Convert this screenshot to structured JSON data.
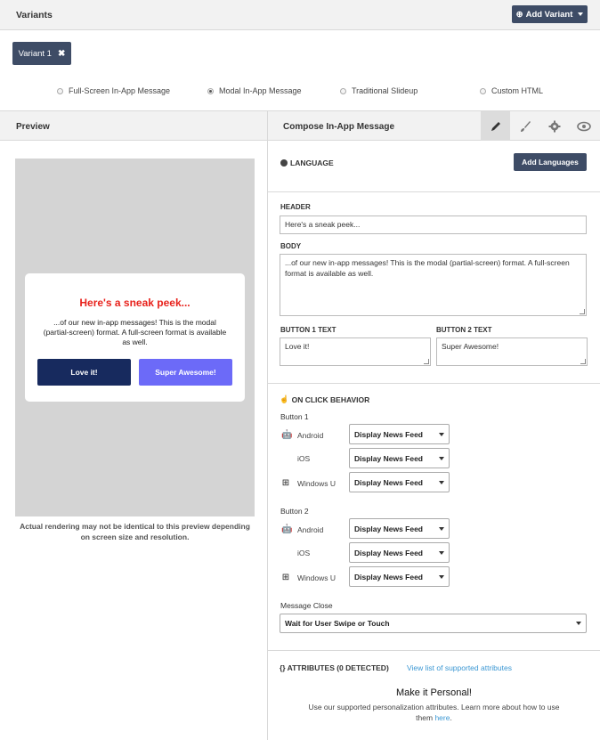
{
  "variants": {
    "title": "Variants",
    "add_variant_label": "Add Variant",
    "chip_label": "Variant 1",
    "chip_close": "✖"
  },
  "message_types": [
    {
      "label": "Full-Screen In-App Message",
      "selected": false
    },
    {
      "label": "Modal In-App Message",
      "selected": true
    },
    {
      "label": "Traditional Slideup",
      "selected": false
    },
    {
      "label": "Custom HTML",
      "selected": false
    }
  ],
  "preview": {
    "title": "Preview",
    "modal_header": "Here's a sneak peek...",
    "modal_body": "...of our new in-app messages! This is the modal (partial-screen) format. A full-screen format is available as well.",
    "button1": "Love it!",
    "button2": "Super Awesome!",
    "note": "Actual rendering may not be identical to this preview depending on screen size and resolution.",
    "header_color": "#e8221c",
    "button1_color": "#172a5e",
    "button2_color": "#6c6af8"
  },
  "compose": {
    "title": "Compose In-App Message",
    "tabs": [
      "pencil-icon",
      "brush-icon",
      "gear-icon",
      "eye-icon"
    ],
    "language_label": "LANGUAGE",
    "add_languages_label": "Add Languages",
    "header_label": "HEADER",
    "header_value": "Here's a sneak peek...",
    "body_label": "BODY",
    "body_value": "...of our new in-app messages! This is the modal (partial-screen) format. A full-screen format is available as well.",
    "button1_label": "BUTTON 1 TEXT",
    "button1_value": "Love it!",
    "button2_label": "BUTTON 2 TEXT",
    "button2_value": "Super Awesome!"
  },
  "on_click": {
    "title": "ON CLICK BEHAVIOR",
    "button1_label": "Button 1",
    "button2_label": "Button 2",
    "platforms": [
      "Android",
      "iOS",
      "Windows U"
    ],
    "behavior_value": "Display News Feed",
    "message_close_label": "Message Close",
    "message_close_value": "Wait for User Swipe or Touch"
  },
  "attributes": {
    "title": "{} ATTRIBUTES (0 DETECTED)",
    "link": "View list of supported attributes",
    "personal_title": "Make it Personal!",
    "personal_text": "Use our supported personalization attributes. Learn more about how to use them",
    "personal_link": "here",
    "personal_end": "."
  },
  "colors": {
    "accent": "#3e4c66",
    "link": "#3b97d3"
  }
}
